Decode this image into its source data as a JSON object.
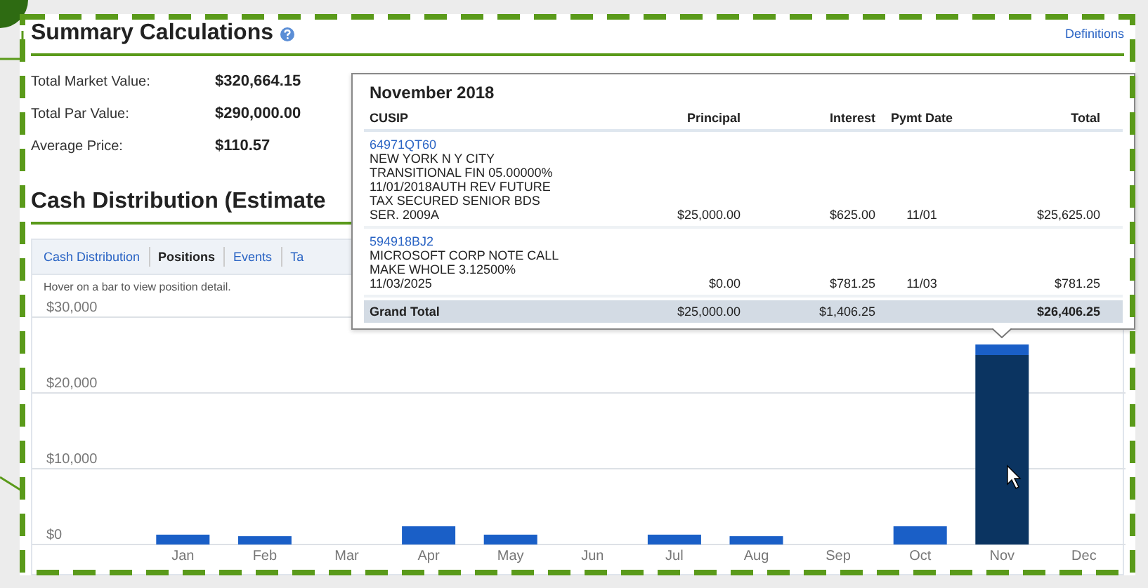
{
  "summary": {
    "title": "Summary Calculations",
    "link": "Definitions",
    "rows": [
      {
        "label": "Total Market Value:",
        "value": "$320,664.15"
      },
      {
        "label": "Total Par Value:",
        "value": "$290,000.00"
      },
      {
        "label": "Average Price:",
        "value": "$110.57"
      }
    ]
  },
  "cash_distribution": {
    "title": "Cash Distribution (Estimate",
    "tabs": [
      {
        "label": "Cash Distribution",
        "selected": false
      },
      {
        "label": "Positions",
        "selected": true
      },
      {
        "label": "Events",
        "selected": false
      },
      {
        "label": "Ta",
        "selected": false
      }
    ],
    "hint": "Hover on a bar to view position detail.",
    "chart_data": {
      "type": "bar",
      "stacked": true,
      "categories": [
        "Jan",
        "Feb",
        "Mar",
        "Apr",
        "May",
        "Jun",
        "Jul",
        "Aug",
        "Sep",
        "Oct",
        "Nov",
        "Dec"
      ],
      "series": [
        {
          "color": "#0b3461",
          "values": [
            0,
            0,
            0,
            0,
            0,
            0,
            0,
            0,
            0,
            0,
            25000,
            0
          ]
        },
        {
          "color": "#1a5fc7",
          "values": [
            1300,
            1100,
            0,
            2400,
            1300,
            0,
            1300,
            1100,
            0,
            2400,
            1400,
            0
          ]
        }
      ],
      "ylim": [
        0,
        30000
      ],
      "yticks": [
        {
          "value": 0,
          "label": "$0"
        },
        {
          "value": 10000,
          "label": "$10,000"
        },
        {
          "value": 20000,
          "label": "$20,000"
        },
        {
          "value": 30000,
          "label": "$30,000"
        }
      ]
    }
  },
  "popover": {
    "title": "November 2018",
    "columns": [
      "CUSIP",
      "Principal",
      "Interest",
      "Pymt Date",
      "Total"
    ],
    "rows": [
      {
        "cusip": "64971QT60",
        "lines": [
          "NEW YORK N Y CITY",
          "TRANSITIONAL FIN 05.00000%",
          "11/01/2018AUTH REV FUTURE",
          "TAX SECURED SENIOR BDS",
          "SER. 2009A"
        ],
        "principal": "$25,000.00",
        "interest": "$625.00",
        "date": "11/01",
        "total": "$25,625.00"
      },
      {
        "cusip": "594918BJ2",
        "lines": [
          "MICROSOFT CORP NOTE CALL",
          "MAKE WHOLE 3.12500%",
          "11/03/2025"
        ],
        "principal": "$0.00",
        "interest": "$781.25",
        "date": "11/03",
        "total": "$781.25"
      }
    ],
    "grand_total": {
      "label": "Grand Total",
      "principal": "$25,000.00",
      "interest": "$1,406.25",
      "total": "$26,406.25"
    }
  }
}
